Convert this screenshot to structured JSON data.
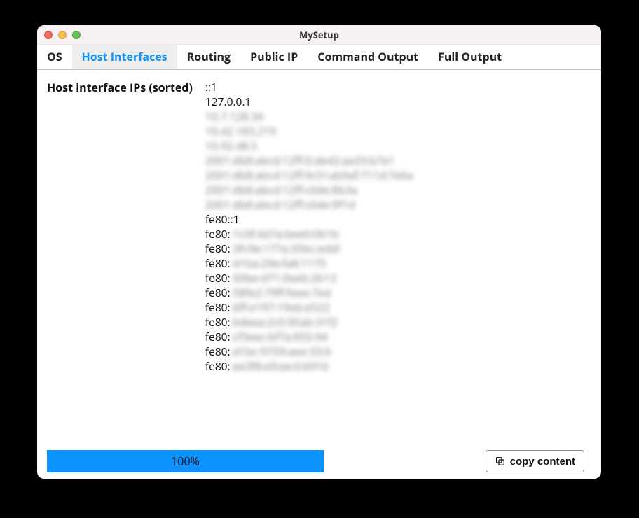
{
  "window": {
    "title": "MySetup"
  },
  "tabs": [
    {
      "label": "OS",
      "active": false
    },
    {
      "label": "Host Interfaces",
      "active": true
    },
    {
      "label": "Routing",
      "active": false
    },
    {
      "label": "Public IP",
      "active": false
    },
    {
      "label": "Command Output",
      "active": false
    },
    {
      "label": "Full Output",
      "active": false
    }
  ],
  "section": {
    "label": "Host interface IPs (sorted)",
    "ips": [
      {
        "text": "::1",
        "blurred": false
      },
      {
        "text": "127.0.0.1",
        "blurred": false
      },
      {
        "text": "10.7.128.34",
        "blurred": true
      },
      {
        "text": "10.42.183.219",
        "blurred": true
      },
      {
        "text": "10.92.48.5",
        "blurred": true
      },
      {
        "text": "2001:db8:abcd:12ff:0:de42:aa33:b7e1",
        "blurred": true
      },
      {
        "text": "2001:db8:abcd:12ff:9c51ab9af:711d:7e6a",
        "blurred": true
      },
      {
        "text": "2001:db8:abcd:12ff:c0de:8b3a",
        "blurred": true
      },
      {
        "text": "2001:db8:abcd:12ff:c0de:9f1d",
        "blurred": true
      },
      {
        "text": "fe80::1",
        "blurred": false
      },
      {
        "prefix": "fe80:",
        "tail": ":1c0f:4d7a:bee0:0b1b",
        "partial": true
      },
      {
        "prefix": "fe80:",
        "tail": ":3fc9e:177a:35bc:edd!",
        "partial": true
      },
      {
        "prefix": "fe80:",
        "tail": ":41ba:29e:fa8:1175",
        "partial": true
      },
      {
        "prefix": "fe80:",
        "tail": ":50be:d71:0eeb:2b13",
        "partial": true
      },
      {
        "prefix": "fe80:",
        "tail": ":58fe2:79ff:feee:7ed",
        "partial": true
      },
      {
        "prefix": "fe80:",
        "tail": ":6ff:e197:19eb:e522",
        "partial": true
      },
      {
        "prefix": "fe80:",
        "tail": ":b4eea:2c0:95ab:31f2",
        "partial": true
      },
      {
        "prefix": "fe80:",
        "tail": ":cf3eec:bf7a:855:94",
        "partial": true
      },
      {
        "prefix": "fe80:",
        "tail": ":d1bc:9759:aee:33:6",
        "partial": true
      },
      {
        "prefix": "fe80:",
        "tail": ":ee3f8:e9:ee:0:6916",
        "partial": true
      }
    ]
  },
  "footer": {
    "progress_text": "100%",
    "copy_label": "copy content"
  }
}
